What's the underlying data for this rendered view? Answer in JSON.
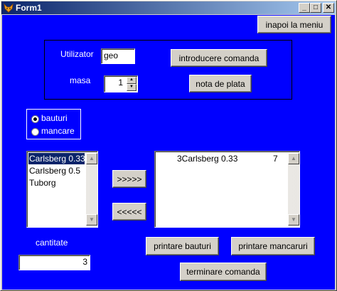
{
  "window": {
    "title": "Form1",
    "minimize": "_",
    "maximize": "□",
    "close": "✕"
  },
  "buttons": {
    "back": "inapoi la meniu",
    "enter_order": "introducere comanda",
    "bill": "nota de plata",
    "add": ">>>>>",
    "remove": "<<<<<",
    "print_drinks": "printare bauturi",
    "print_food": "printare mancaruri",
    "finish_order": "terminare comanda"
  },
  "fields": {
    "user_label": "Utilizator",
    "user_value": "geo",
    "table_label": "masa",
    "table_value": "1",
    "quantity_label": "cantitate",
    "quantity_value": "3"
  },
  "category": {
    "options": [
      "bauturi",
      "mancare"
    ],
    "selected": "bauturi"
  },
  "products": {
    "items": [
      "Carlsberg 0.33",
      "Carlsberg 0.5",
      "Tuborg"
    ],
    "selected_index": 0
  },
  "order": {
    "rows": [
      {
        "qty_name": "3Carlsberg 0.33",
        "price": "7"
      }
    ]
  },
  "colors": {
    "client_bg": "#0000ff",
    "title_bar": "#0a246a",
    "selection": "#0a246a"
  },
  "icons": {
    "app": "fox-icon",
    "scroll_up": "up-arrow",
    "scroll_down": "down-arrow"
  }
}
